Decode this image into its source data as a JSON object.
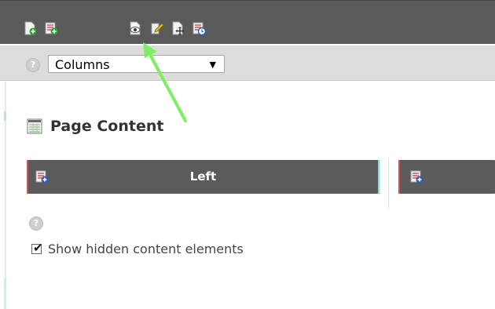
{
  "toolbar": {
    "icons": [
      {
        "name": "new-page-icon"
      },
      {
        "name": "new-record-icon"
      },
      {
        "name": "view-page-icon"
      },
      {
        "name": "edit-page-icon"
      },
      {
        "name": "move-page-icon"
      },
      {
        "name": "page-history-icon"
      }
    ]
  },
  "view_selector": {
    "selected": "Columns"
  },
  "content": {
    "title": "Page Content",
    "columns": [
      {
        "label": "Left"
      },
      {
        "label": ""
      }
    ],
    "show_hidden_label": "Show hidden content elements",
    "show_hidden_checked": true
  },
  "annotation": {
    "arrow_color": "#7cf060"
  }
}
